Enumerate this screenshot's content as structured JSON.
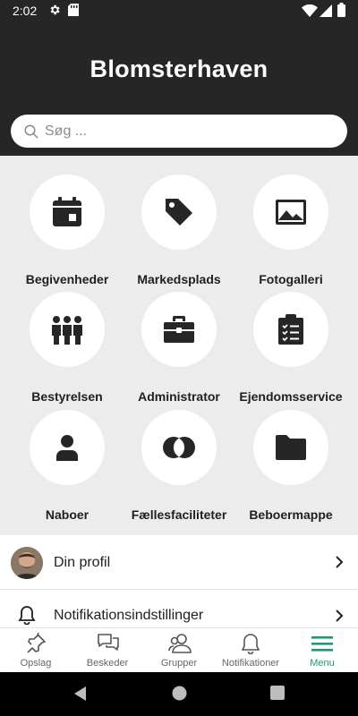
{
  "status_bar": {
    "time": "2:02"
  },
  "header": {
    "title": "Blomsterhaven"
  },
  "search": {
    "placeholder": "Søg ..."
  },
  "tiles": [
    {
      "label": "Begivenheder",
      "icon": "calendar-icon"
    },
    {
      "label": "Markedsplads",
      "icon": "tag-icon"
    },
    {
      "label": "Fotogalleri",
      "icon": "image-icon"
    },
    {
      "label": "Bestyrelsen",
      "icon": "group-icon"
    },
    {
      "label": "Administrator",
      "icon": "briefcase-icon"
    },
    {
      "label": "Ejendomsservice",
      "icon": "clipboard-check-icon"
    },
    {
      "label": "Naboer",
      "icon": "person-icon"
    },
    {
      "label": "Fællesfaciliteter",
      "icon": "intersecting-circles-icon"
    },
    {
      "label": "Beboermappe",
      "icon": "folder-icon"
    }
  ],
  "list": [
    {
      "label": "Din profil",
      "icon": "avatar"
    },
    {
      "label": "Notifikationsindstillinger",
      "icon": "bell-icon"
    }
  ],
  "bottom_nav": [
    {
      "label": "Opslag",
      "icon": "pin-icon",
      "active": false
    },
    {
      "label": "Beskeder",
      "icon": "chat-icon",
      "active": false
    },
    {
      "label": "Grupper",
      "icon": "people-icon",
      "active": false
    },
    {
      "label": "Notifikationer",
      "icon": "bell-icon",
      "active": false
    },
    {
      "label": "Menu",
      "icon": "hamburger-icon",
      "active": true
    }
  ],
  "colors": {
    "header_bg": "#262626",
    "accent": "#1f9a6a",
    "icon_dark": "#262626"
  }
}
